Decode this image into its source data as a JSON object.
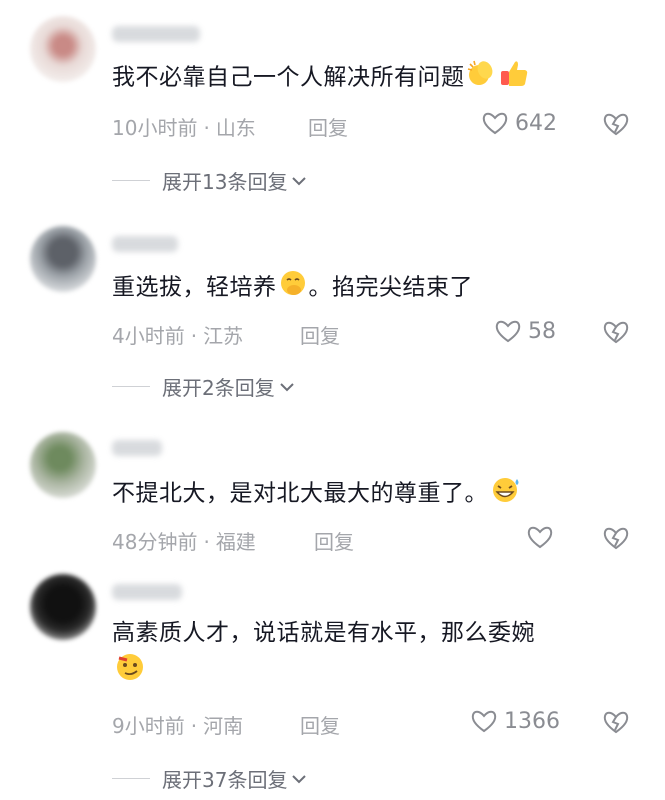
{
  "comments": [
    {
      "text": "我不必靠自己一个人解决所有问题",
      "emojis": [
        "clapping-hands-icon",
        "thumbs-up-icon"
      ],
      "time": "10小时前",
      "location": "山东",
      "reply_label": "回复",
      "likes": "642",
      "expand_label": "展开13条回复"
    },
    {
      "text_before": "重选拔，轻培养",
      "text_after": "。掐完尖结束了",
      "emojis": [
        "hand-over-mouth-face-icon"
      ],
      "time": "4小时前",
      "location": "江苏",
      "reply_label": "回复",
      "likes": "58",
      "expand_label": "展开2条回复"
    },
    {
      "text": "不提北大，是对北大最大的尊重了。",
      "emojis": [
        "grinning-sweat-face-icon"
      ],
      "time": "48分钟前",
      "location": "福建",
      "reply_label": "回复",
      "likes": ""
    },
    {
      "text": "高素质人才，说话就是有水平，那么委婉",
      "emojis": [
        "smug-face-icon"
      ],
      "time": "9小时前",
      "location": "河南",
      "reply_label": "回复",
      "likes": "1366",
      "expand_label": "展开37条回复"
    }
  ],
  "colors": {
    "text": "#161823",
    "meta": "#a4a6ab",
    "icon": "#8a8c92"
  }
}
